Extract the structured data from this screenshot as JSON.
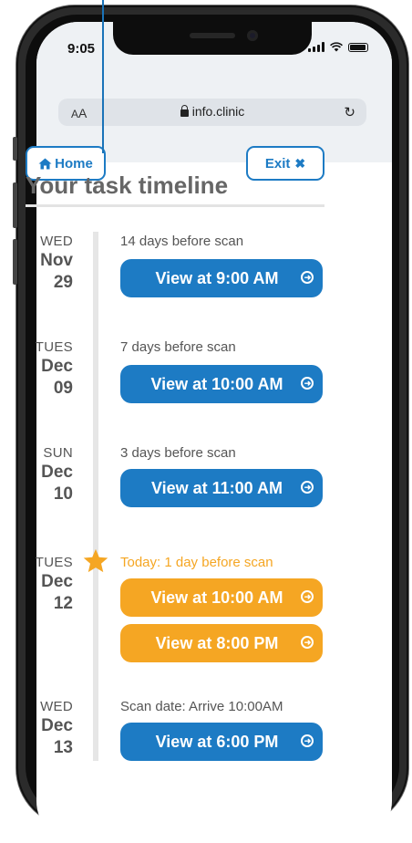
{
  "status_bar": {
    "time": "9:05"
  },
  "browser": {
    "text_size_small": "A",
    "text_size_big": "A",
    "url": "info.clinic",
    "reload_icon": "↻"
  },
  "nav": {
    "home_label": "Home",
    "exit_label": "Exit"
  },
  "page": {
    "title": "Your task timeline"
  },
  "timeline": [
    {
      "dow": "WED",
      "month": "Nov",
      "day": "29",
      "note": "14 days before scan",
      "buttons": [
        "View at 9:00 AM"
      ],
      "highlight": false
    },
    {
      "dow": "TUES",
      "month": "Dec",
      "day": "09",
      "note": "7 days before scan",
      "buttons": [
        "View at 10:00 AM"
      ],
      "highlight": false
    },
    {
      "dow": "SUN",
      "month": "Dec",
      "day": "10",
      "note": "3 days before scan",
      "buttons": [
        "View at 11:00 AM"
      ],
      "highlight": false
    },
    {
      "dow": "TUES",
      "month": "Dec",
      "day": "12",
      "note": "Today: 1 day before scan",
      "buttons": [
        "View at 10:00 AM",
        "View at 8:00 PM"
      ],
      "highlight": true
    },
    {
      "dow": "WED",
      "month": "Dec",
      "day": "13",
      "note": "Scan date: Arrive 10:00AM",
      "buttons": [
        "View at 6:00 PM"
      ],
      "highlight": false
    }
  ],
  "colors": {
    "primary": "#1d7bc4",
    "today": "#f5a623",
    "text": "#555555"
  },
  "icons": {
    "home": "home-icon",
    "exit": "close-icon",
    "today_marker": "star-icon",
    "button_arrow": "arrow-right-circle-icon"
  }
}
